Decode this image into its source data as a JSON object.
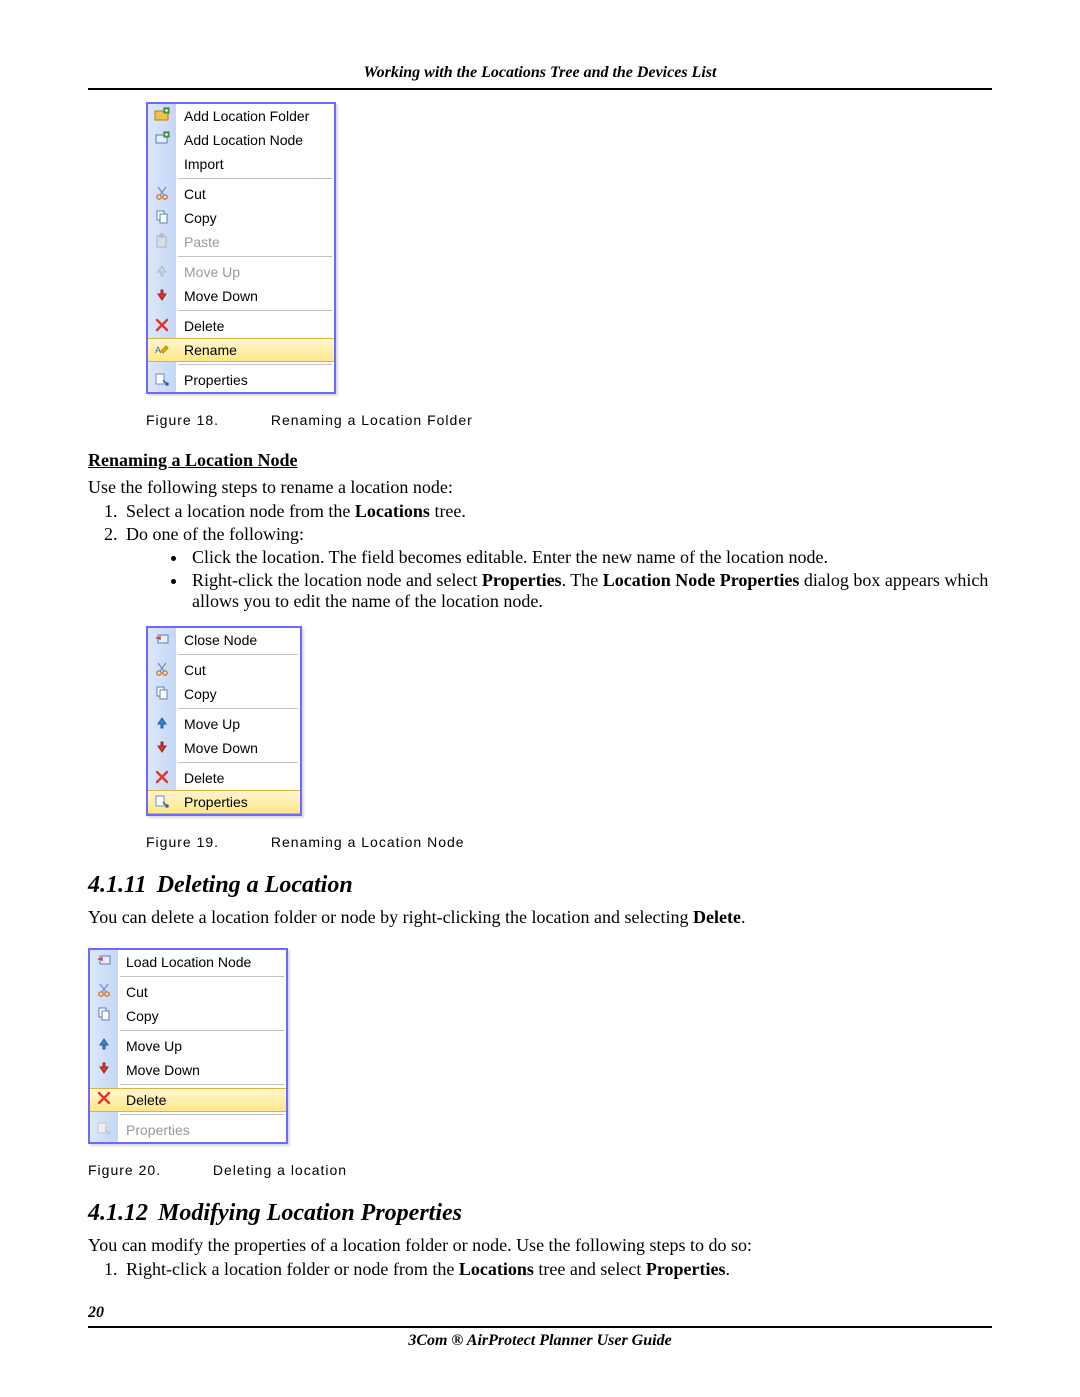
{
  "header": {
    "title": "Working with the Locations Tree and the Devices List"
  },
  "menu1": {
    "items": {
      "add_folder": "Add Location Folder",
      "add_node": "Add Location Node",
      "import": "Import",
      "cut": "Cut",
      "copy": "Copy",
      "paste": "Paste",
      "move_up": "Move Up",
      "move_down": "Move Down",
      "delete": "Delete",
      "rename": "Rename",
      "properties": "Properties"
    }
  },
  "figure18": {
    "label": "Figure 18.",
    "caption": "Renaming a Location Folder"
  },
  "section_rename_node": {
    "heading": "Renaming a Location Node",
    "intro": "Use the following steps to rename a location node:",
    "step1_pre": "Select a location node from the ",
    "step1_bold": "Locations",
    "step1_post": " tree.",
    "step2": "Do one of the following:",
    "bullet1": "Click the location. The field becomes editable. Enter the new name of the location node.",
    "bullet2_pre": "Right-click the location node and select ",
    "bullet2_b1": "Properties",
    "bullet2_mid": ". The ",
    "bullet2_b2": "Location Node Properties",
    "bullet2_post": " dialog box appears which allows you to edit the name of the location node."
  },
  "menu2": {
    "items": {
      "close_node": "Close Node",
      "cut": "Cut",
      "copy": "Copy",
      "move_up": "Move Up",
      "move_down": "Move Down",
      "delete": "Delete",
      "properties": "Properties"
    }
  },
  "figure19": {
    "label": "Figure 19.",
    "caption": "Renaming a Location Node"
  },
  "section_delete": {
    "num": "4.1.11",
    "title": "Deleting a Location",
    "text_pre": "You can delete a location folder or node by right-clicking the location and selecting ",
    "text_bold": "Delete",
    "text_post": "."
  },
  "menu3": {
    "items": {
      "load_node": "Load Location Node",
      "cut": "Cut",
      "copy": "Copy",
      "move_up": "Move Up",
      "move_down": "Move Down",
      "delete": "Delete",
      "properties": "Properties"
    }
  },
  "figure20": {
    "label": "Figure 20.",
    "caption": "Deleting a location"
  },
  "section_modify": {
    "num": "4.1.12",
    "title": "Modifying Location Properties",
    "intro": "You can modify the properties of a location folder or node. Use the following steps to do so:",
    "step1_pre": "Right-click a location folder or node from the ",
    "step1_b1": "Locations",
    "step1_mid": " tree and select ",
    "step1_b2": "Properties",
    "step1_post": "."
  },
  "page_number": "20",
  "footer": {
    "title": "3Com ® AirProtect Planner User Guide"
  }
}
